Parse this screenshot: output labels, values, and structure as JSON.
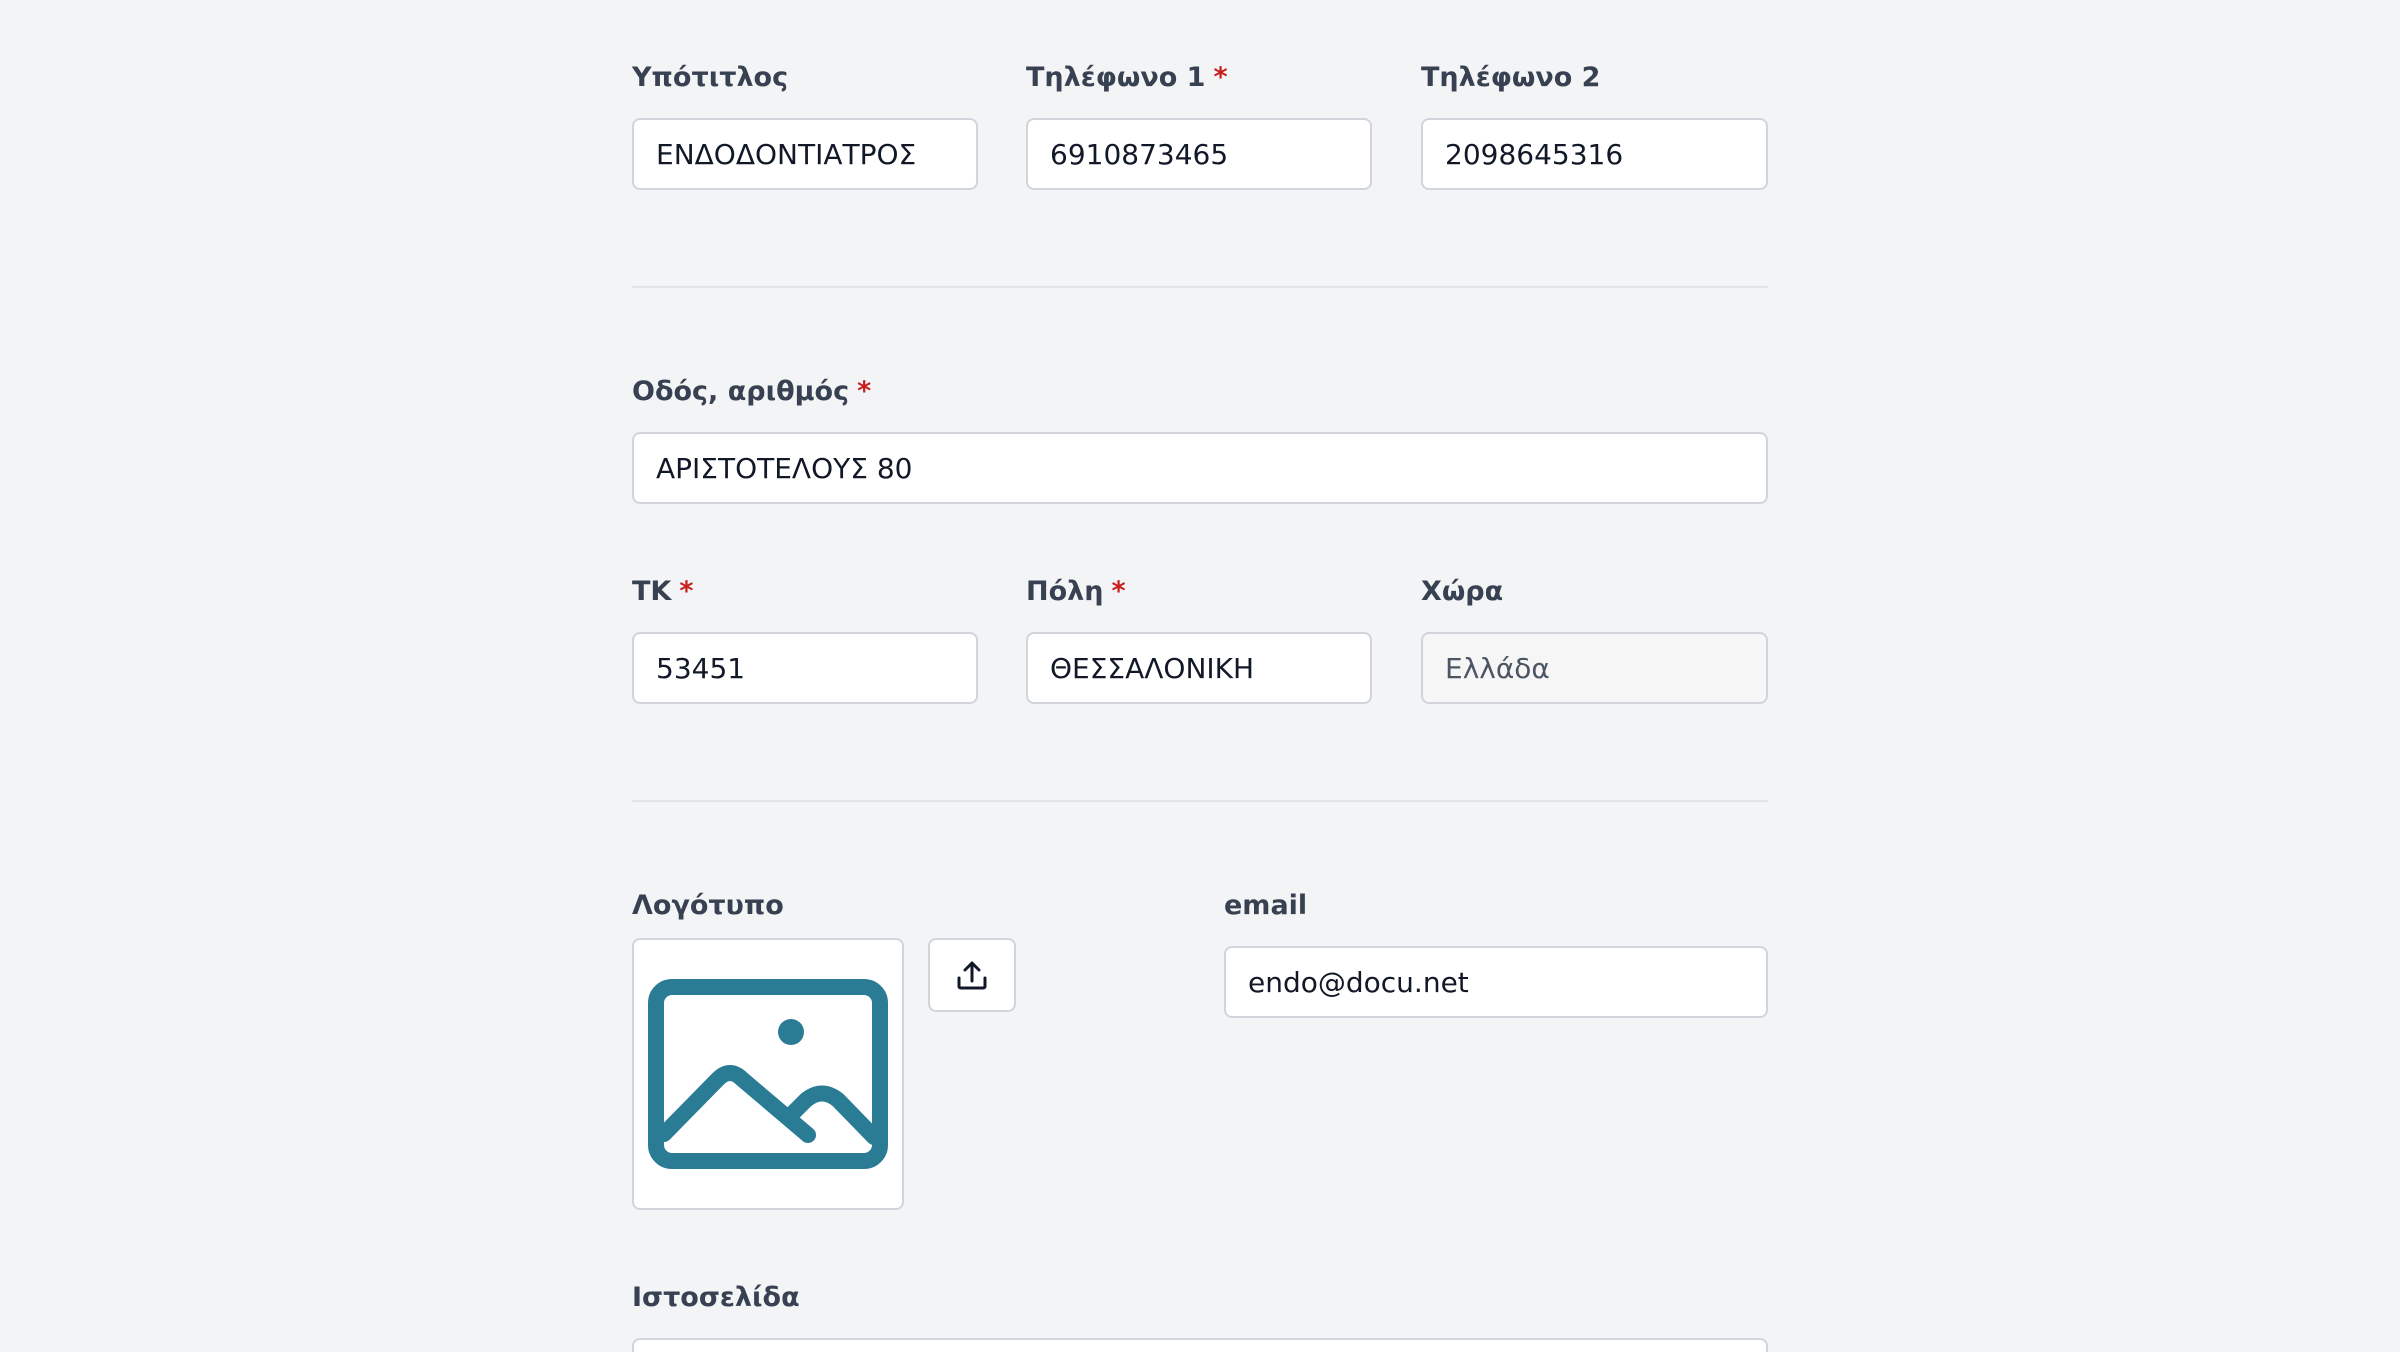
{
  "fields": {
    "subtitle": {
      "label": "Υπότιτλος",
      "value": "ΕΝΔΟΔΟΝΤΙΑΤΡΟΣ"
    },
    "phone1": {
      "label": "Τηλέφωνο 1",
      "required_mark": "*",
      "value": "6910873465"
    },
    "phone2": {
      "label": "Τηλέφωνο 2",
      "value": "2098645316"
    },
    "street": {
      "label": "Οδός, αριθμός",
      "required_mark": "*",
      "value": "ΑΡΙΣΤΟΤΕΛΟΥΣ 80"
    },
    "postal_code": {
      "label": "ΤΚ",
      "required_mark": "*",
      "value": "53451"
    },
    "city": {
      "label": "Πόλη",
      "required_mark": "*",
      "value": "ΘΕΣΣΑΛΟΝΙΚΗ"
    },
    "country": {
      "label": "Χώρα",
      "value": "Ελλάδα"
    },
    "logo": {
      "label": "Λογότυπο",
      "placeholder_icon": "image-placeholder-icon",
      "upload_icon": "upload-icon"
    },
    "email": {
      "label": "email",
      "value": "endo@docu.net"
    },
    "website": {
      "label": "Ιστοσελίδα",
      "value": ""
    }
  },
  "colors": {
    "required": "#c81e1e",
    "logo_placeholder": "#2a7b94",
    "label": "#374151"
  }
}
